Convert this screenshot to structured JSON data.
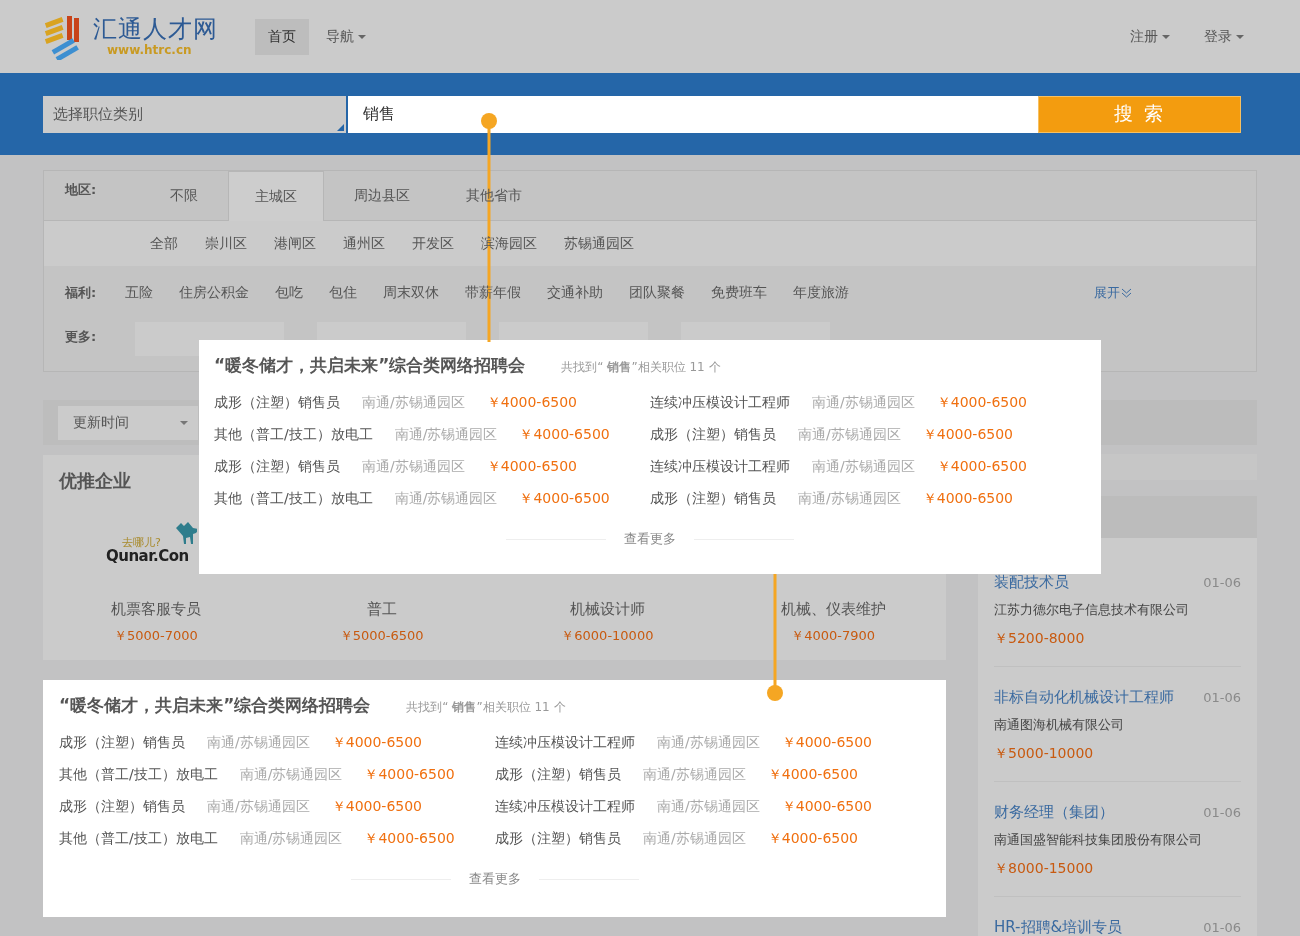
{
  "header": {
    "logo": {
      "name": "汇通人才网",
      "url": "www.htrc.cn"
    },
    "nav": [
      {
        "label": "首页",
        "selected": true,
        "dropdown": false
      },
      {
        "label": "导航",
        "selected": false,
        "dropdown": true
      }
    ],
    "account": [
      {
        "label": "注册",
        "dropdown": true
      },
      {
        "label": "登录",
        "dropdown": true
      }
    ]
  },
  "search": {
    "category_placeholder": "选择职位类别",
    "value": "销售",
    "button": "搜 索"
  },
  "filters": {
    "region_label": "地区:",
    "region_tabs": [
      {
        "label": "不限",
        "selected": false
      },
      {
        "label": "主城区",
        "selected": true
      },
      {
        "label": "周边县区",
        "selected": false
      },
      {
        "label": "其他省市",
        "selected": false
      }
    ],
    "districts": [
      "全部",
      "崇川区",
      "港闸区",
      "通州区",
      "开发区",
      "滨海园区",
      "苏锡通园区"
    ],
    "benefits_label": "福利:",
    "benefits": [
      "五险",
      "住房公积金",
      "包吃",
      "包住",
      "周末双休",
      "带薪年假",
      "交通补助",
      "团队聚餐",
      "免费班车",
      "年度旅游"
    ],
    "expand": "展开",
    "more_label": "更多:"
  },
  "sort": {
    "label": "更新时间"
  },
  "featured": {
    "title": "优推企业",
    "logo_texts": [
      "去哪儿?",
      "Qunar.Con"
    ],
    "jobs": [
      {
        "title": "机票客服专员",
        "salary": "￥5000-7000"
      },
      {
        "title": "普工",
        "salary": "￥5000-6500"
      },
      {
        "title": "机械设计师",
        "salary": "￥6000-10000"
      },
      {
        "title": "机械、仪表维护",
        "salary": "￥4000-7900"
      }
    ]
  },
  "fair": {
    "title": "“暖冬储才，共启未来”综合类网络招聘会",
    "count": "共找到“ **销售**”相关职位 11 个",
    "more": "查看更多",
    "jobs": [
      {
        "title": "成形（注塑）销售员",
        "location": "南通/苏锡通园区",
        "salary": "￥4000-6500"
      },
      {
        "title": "连续冲压模设计工程师",
        "location": "南通/苏锡通园区",
        "salary": "￥4000-6500"
      },
      {
        "title": "其他（普工/技工）放电工",
        "location": "南通/苏锡通园区",
        "salary": "￥4000-6500"
      },
      {
        "title": "成形（注塑）销售员",
        "location": "南通/苏锡通园区",
        "salary": "￥4000-6500"
      },
      {
        "title": "成形（注塑）销售员",
        "location": "南通/苏锡通园区",
        "salary": "￥4000-6500"
      },
      {
        "title": "连续冲压模设计工程师",
        "location": "南通/苏锡通园区",
        "salary": "￥4000-6500"
      },
      {
        "title": "其他（普工/技工）放电工",
        "location": "南通/苏锡通园区",
        "salary": "￥4000-6500"
      },
      {
        "title": "成形（注塑）销售员",
        "location": "南通/苏锡通园区",
        "salary": "￥4000-6500"
      }
    ]
  },
  "popup": {
    "title": "“暖冬储才，共启未来”综合类网络招聘会",
    "count": "共找到“ **销售**”相关职位 11 个",
    "more": "查看更多",
    "jobs": [
      {
        "title": "成形（注塑）销售员",
        "location": "南通/苏锡通园区",
        "salary": "￥4000-6500"
      },
      {
        "title": "连续冲压模设计工程师",
        "location": "南通/苏锡通园区",
        "salary": "￥4000-6500"
      },
      {
        "title": "其他（普工/技工）放电工",
        "location": "南通/苏锡通园区",
        "salary": "￥4000-6500"
      },
      {
        "title": "成形（注塑）销售员",
        "location": "南通/苏锡通园区",
        "salary": "￥4000-6500"
      },
      {
        "title": "成形（注塑）销售员",
        "location": "南通/苏锡通园区",
        "salary": "￥4000-6500"
      },
      {
        "title": "连续冲压模设计工程师",
        "location": "南通/苏锡通园区",
        "salary": "￥4000-6500"
      },
      {
        "title": "其他（普工/技工）放电工",
        "location": "南通/苏锡通园区",
        "salary": "￥4000-6500"
      },
      {
        "title": "成形（注塑）销售员",
        "location": "南通/苏锡通园区",
        "salary": "￥4000-6500"
      }
    ]
  },
  "sidebar": {
    "jobs": [
      {
        "title": "装配技术员",
        "date": "01-06",
        "company": "江苏力德尔电子信息技术有限公司",
        "salary": "￥5200-8000"
      },
      {
        "title": "非标自动化机械设计工程师",
        "date": "01-06",
        "company": "南通图海机械有限公司",
        "salary": "￥5000-10000"
      },
      {
        "title": "财务经理（集团）",
        "date": "01-06",
        "company": "南通国盛智能科技集团股份有限公司",
        "salary": "￥8000-15000"
      },
      {
        "title": "HR-招聘&培训专员",
        "date": "01-06"
      }
    ]
  }
}
